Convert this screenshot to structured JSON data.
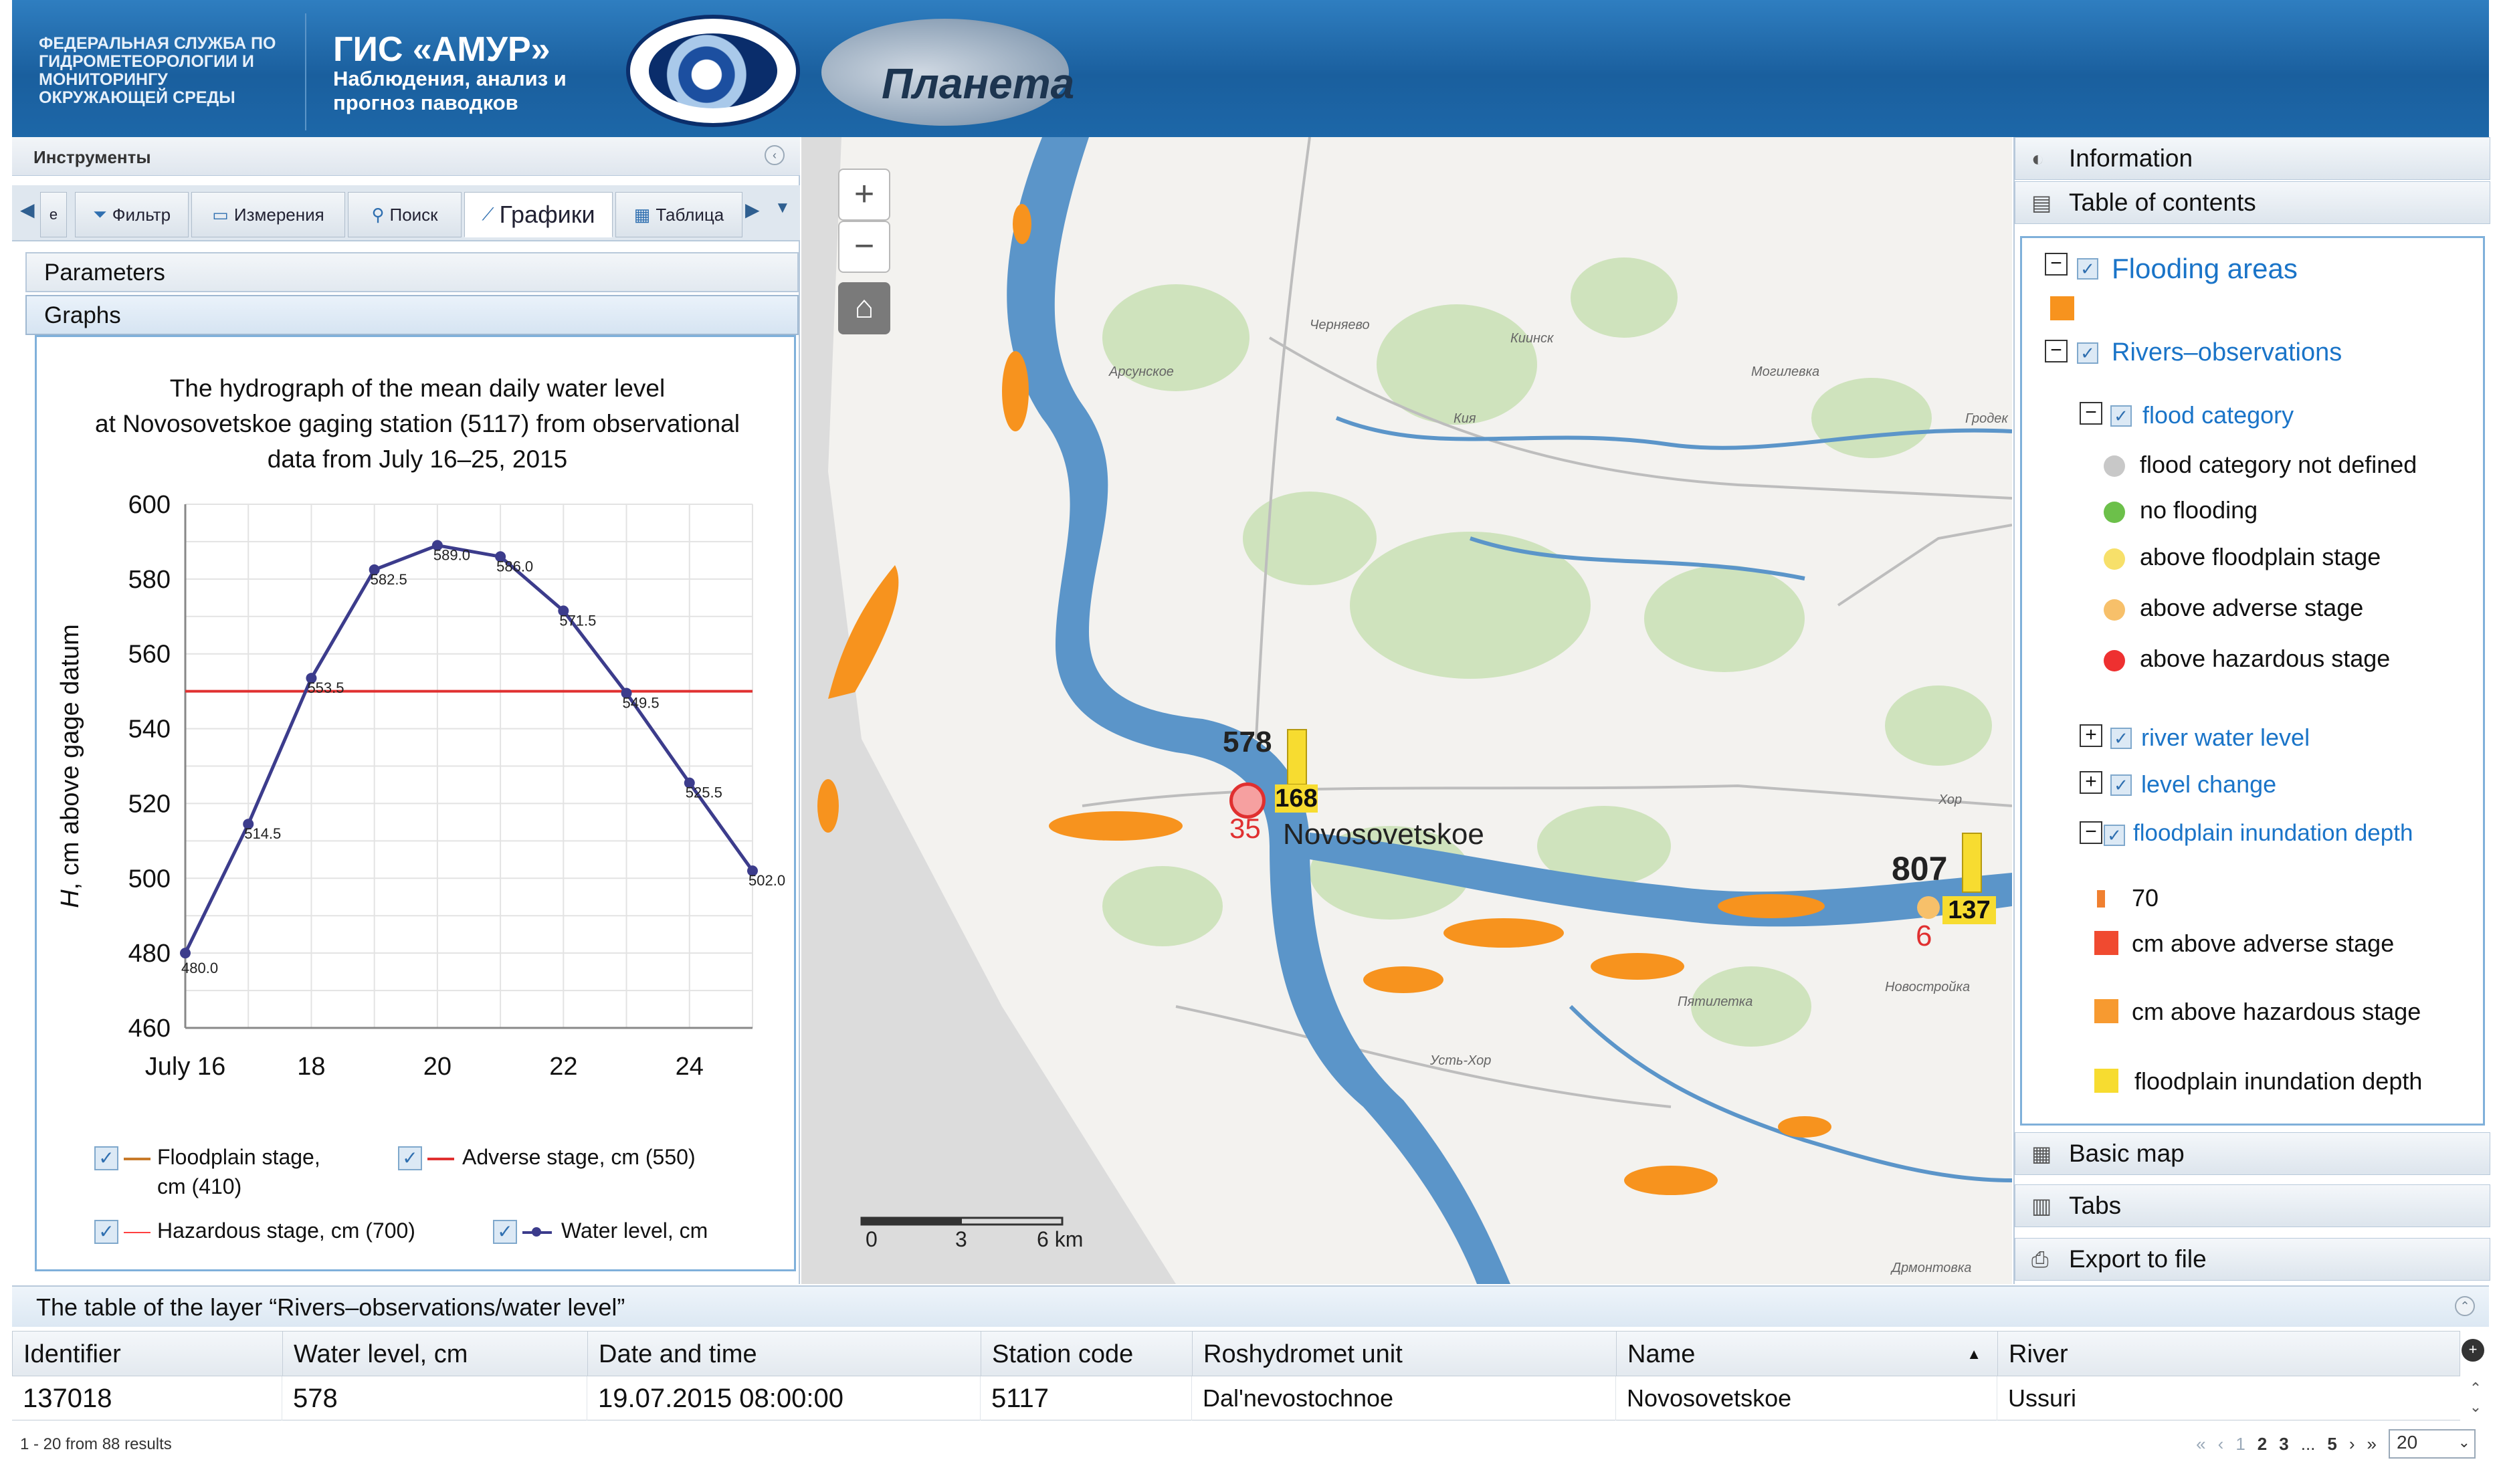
{
  "header": {
    "agency": "Федеральная служба по гидрометеорологии и мониторингу окружающей среды",
    "title": "ГИС «АМУР»",
    "subtitle": "Наблюдения, анализ и прогноз паводков",
    "logo_planeta": "Планета"
  },
  "tools": {
    "title": "Инструменты",
    "tabs": [
      {
        "label": "Фильтр",
        "icon": "filter-icon"
      },
      {
        "label": "Измерения",
        "icon": "measure-icon"
      },
      {
        "label": "Поиск",
        "icon": "search-icon"
      },
      {
        "label": "Графики",
        "icon": "chart-icon"
      },
      {
        "label": "Таблица",
        "icon": "table-icon"
      }
    ],
    "parameters_label": "Parameters",
    "graphs_label": "Graphs"
  },
  "chart_data": {
    "type": "line",
    "title": "The hydrograph of the mean daily water level at Novosovetskoe gaging station (5117) from observational data from July 16–25, 2015",
    "title_lines": [
      "The hydrograph of the mean daily water level",
      "at Novosovetskoe gaging station (5117) from observational",
      "data from July 16–25, 2015"
    ],
    "ylabel_italic": "H",
    "ylabel": ", cm above gage datum",
    "xlabel": "",
    "x_ticks": [
      "July 16",
      "18",
      "20",
      "22",
      "24"
    ],
    "x_tick_values": [
      16,
      18,
      20,
      22,
      24
    ],
    "y_ticks": [
      460,
      480,
      500,
      520,
      540,
      560,
      580,
      600
    ],
    "xlim": [
      16,
      25
    ],
    "ylim": [
      460,
      600
    ],
    "grid": true,
    "series": [
      {
        "name": "Water level, cm",
        "color": "#3c3c8c",
        "x": [
          16,
          17,
          18,
          19,
          20,
          21,
          22,
          23,
          24,
          25
        ],
        "values": [
          480.0,
          514.5,
          553.5,
          582.5,
          589.0,
          586.0,
          571.5,
          549.5,
          525.5,
          502.0
        ],
        "labels": [
          "480.0",
          "514.5",
          "553.5",
          "582.5",
          "589.0",
          "586.0",
          "571.5",
          "549.5",
          "525.5",
          "502.0"
        ]
      }
    ],
    "reference_lines": [
      {
        "name": "Adverse stage",
        "value": 550,
        "color": "#e03030"
      }
    ],
    "legend": [
      {
        "label": "Floodplain stage,",
        "label2": "cm (410)",
        "color": "#c87a2a",
        "style": "line"
      },
      {
        "label": "Adverse stage,  cm (550)",
        "color": "#e03030",
        "style": "line"
      },
      {
        "label": "Hazardous stage,  cm (700)",
        "color": "#ff4040",
        "style": "thin-line"
      },
      {
        "label": "Water level, cm",
        "color": "#3c3c8c",
        "style": "line-dot"
      }
    ]
  },
  "map": {
    "zoom_in": "+",
    "zoom_out": "−",
    "station": {
      "name": "Novosovetskoe",
      "level": "578",
      "depth": "168",
      "change": "35"
    },
    "station2": {
      "level": "807",
      "depth": "137",
      "change": "6"
    },
    "scale": {
      "labels": [
        "0",
        "3",
        "6 km"
      ]
    },
    "place_labels": [
      "Черняево",
      "Арсунское",
      "Киинск",
      "Могилевка",
      "Гродек",
      "Хор",
      "Новостройка",
      "Пятилетка",
      "Усть-Хор",
      "Дрмонтовка",
      "Кия"
    ]
  },
  "right_panel": {
    "information": "Information",
    "toc_title": "Table of contents",
    "toc": {
      "flooding_areas": "Flooding areas",
      "rivers_observations": "Rivers–observations",
      "flood_category": "flood category",
      "categories": [
        {
          "label": "flood category not defined",
          "color": "#c8c8c8"
        },
        {
          "label": "no flooding",
          "color": "#6cc04a"
        },
        {
          "label": "above floodplain stage",
          "color": "#f7e06a"
        },
        {
          "label": "above adverse stage",
          "color": "#f7c06a"
        },
        {
          "label": "above hazardous stage",
          "color": "#ee3030"
        }
      ],
      "river_water_level": "river water level",
      "level_change": "level change",
      "floodplain_inundation_depth": "floodplain inundation depth",
      "depth_items": [
        {
          "label": "70",
          "color": "#f08030"
        },
        {
          "label": "cm above adverse stage",
          "color": "#f04a30"
        },
        {
          "label": "cm above hazardous stage",
          "color": "#f79a30"
        },
        {
          "label": "floodplain inundation depth",
          "color": "#f7dc30"
        }
      ],
      "flooding_color": "#f7931e"
    },
    "basic_map": "Basic map",
    "tabs": "Tabs",
    "export": "Export to file"
  },
  "table": {
    "title": "The table of the layer “Rivers–observations/water level”",
    "columns": [
      "Identifier",
      "Water level, cm",
      "Date and time",
      "Station code",
      "Roshydromet unit",
      "Name",
      "River"
    ],
    "rows": [
      [
        "137018",
        "578",
        "19.07.2015 08:00:00",
        "5117",
        "Dal'nevostochnoe",
        "Novosovetskoe",
        "Ussuri"
      ]
    ],
    "results_text": "1 - 20 from 88 results",
    "pager": {
      "pages": [
        "1",
        "2",
        "3",
        "...",
        "5"
      ],
      "page_size": "20"
    }
  }
}
